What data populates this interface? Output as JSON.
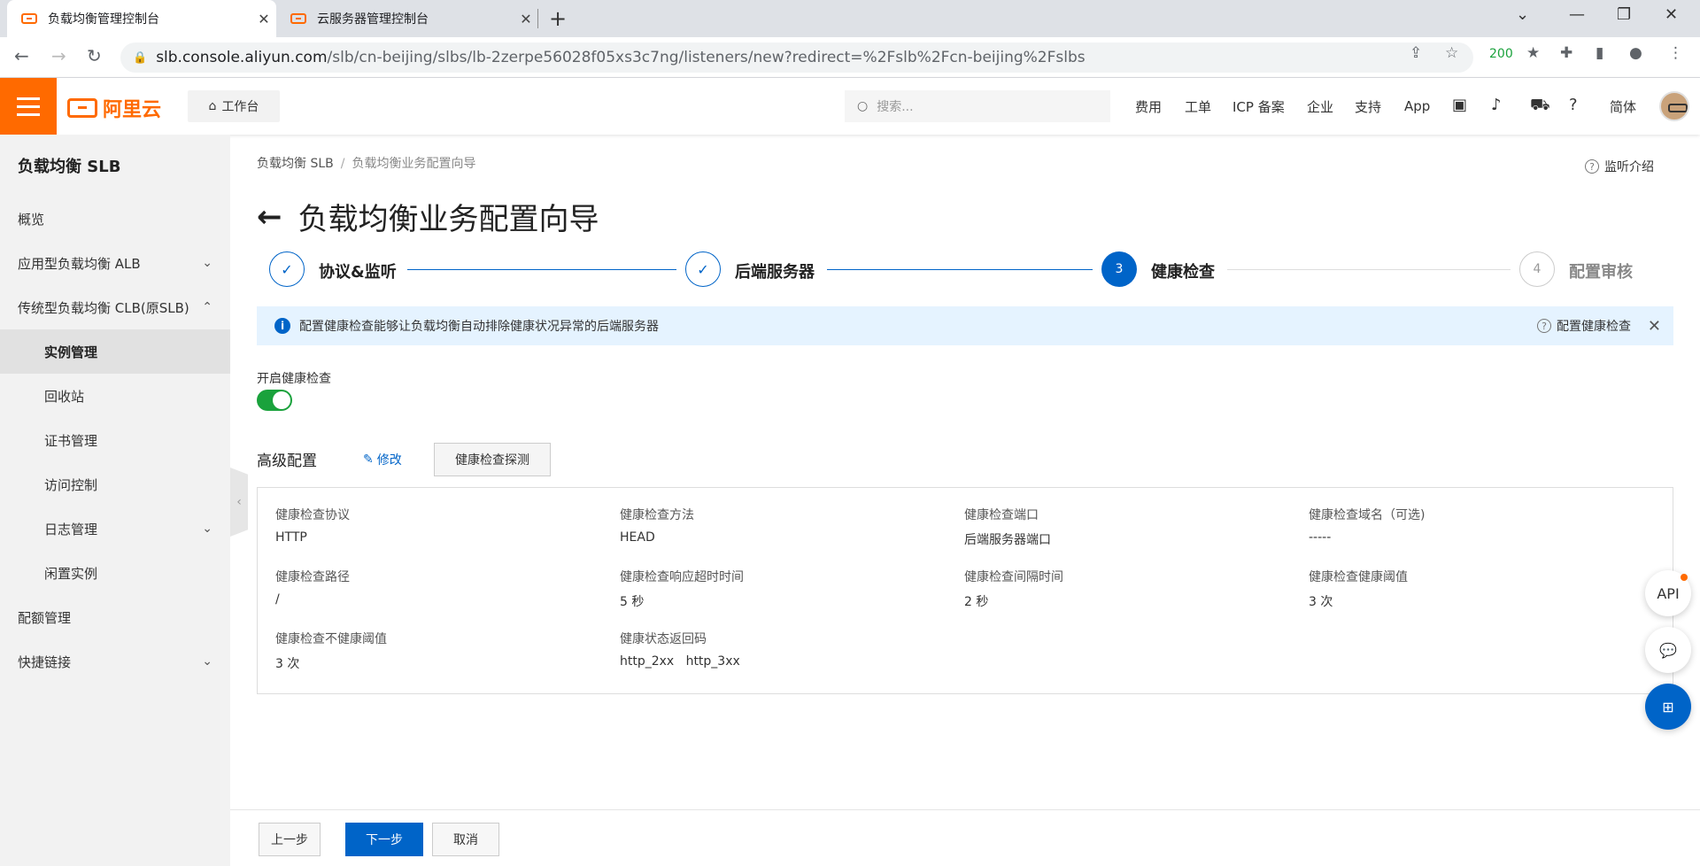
{
  "browser": {
    "tabs": [
      {
        "title": "负载均衡管理控制台",
        "active": true
      },
      {
        "title": "云服务器管理控制台",
        "active": false
      }
    ],
    "url_host": "slb.console.aliyun.com",
    "url_path": "/slb/cn-beijing/slbs/lb-2zerpe56028f05xs3c7ng/listeners/new?redirect=%2Fslb%2Fcn-beijing%2Fslbs",
    "ext_badge": "200"
  },
  "header": {
    "logo_text": "阿里云",
    "workbench": "工作台",
    "search_placeholder": "搜索...",
    "nav": [
      "费用",
      "工单",
      "ICP 备案",
      "企业",
      "支持",
      "App"
    ],
    "lang": "简体"
  },
  "sidebar": {
    "title": "负载均衡 SLB",
    "items": [
      {
        "label": "概览"
      },
      {
        "label": "应用型负载均衡 ALB"
      },
      {
        "label": "传统型负载均衡 CLB(原SLB)"
      },
      {
        "label": "实例管理"
      },
      {
        "label": "回收站"
      },
      {
        "label": "证书管理"
      },
      {
        "label": "访问控制"
      },
      {
        "label": "日志管理"
      },
      {
        "label": "闲置实例"
      },
      {
        "label": "配额管理"
      },
      {
        "label": "快捷链接"
      }
    ]
  },
  "main": {
    "breadcrumb": [
      "负载均衡 SLB",
      "/",
      "负载均衡业务配置向导"
    ],
    "listen_intro": "监听介绍",
    "title": "负载均衡业务配置向导",
    "steps": [
      {
        "num": "",
        "label": "协议&监听",
        "state": "done"
      },
      {
        "num": "",
        "label": "后端服务器",
        "state": "done"
      },
      {
        "num": "3",
        "label": "健康检查",
        "state": "current"
      },
      {
        "num": "4",
        "label": "配置审核",
        "state": "todo"
      }
    ],
    "notice": "配置健康检查能够让负载均衡自动排除健康状况异常的后端服务器",
    "notice_link": "配置健康检查",
    "toggle_label": "开启健康检查",
    "advanced_title": "高级配置",
    "edit_label": "修改",
    "probe_button": "健康检查探测",
    "config": [
      {
        "k": "健康检查协议",
        "v": "HTTP"
      },
      {
        "k": "健康检查方法",
        "v": "HEAD"
      },
      {
        "k": "健康检查端口",
        "v": "后端服务器端口"
      },
      {
        "k": "健康检查域名（可选)",
        "v": "-----"
      },
      {
        "k": "健康检查路径",
        "v": "/"
      },
      {
        "k": "健康检查响应超时时间",
        "v": "5 秒"
      },
      {
        "k": "健康检查间隔时间",
        "v": "2 秒"
      },
      {
        "k": "健康检查健康阈值",
        "v": "3 次"
      },
      {
        "k": "健康检查不健康阈值",
        "v": "3 次"
      },
      {
        "k": "健康状态返回码",
        "v": "http_2xx   http_3xx"
      }
    ]
  },
  "fabs": {
    "api": "API"
  },
  "footer": {
    "prev": "上一步",
    "next": "下一步",
    "cancel": "取消"
  },
  "colors": {
    "brand": "#ff6a00",
    "primary": "#0064c8",
    "toggle_on": "#1aa23c"
  }
}
